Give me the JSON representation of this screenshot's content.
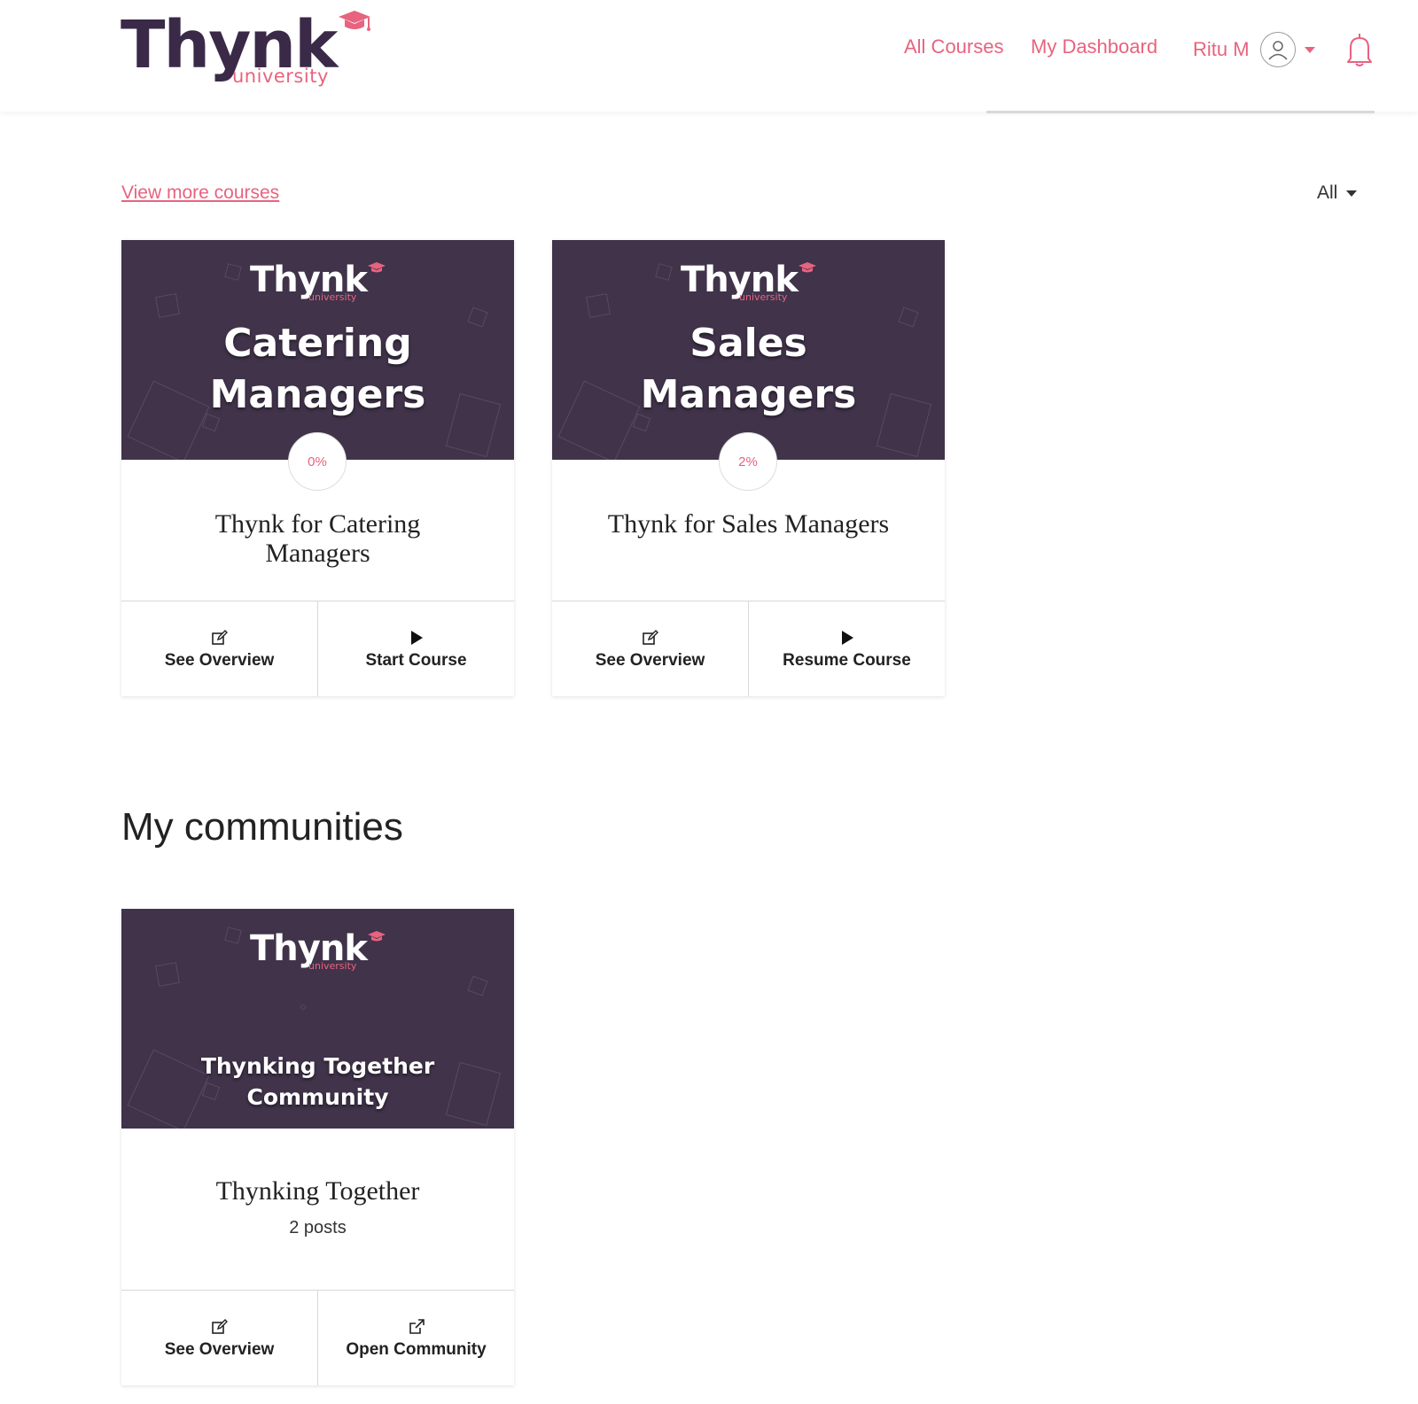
{
  "brand": {
    "name": "Thynk",
    "sub": "university",
    "colors": {
      "primary": "#3a2a48",
      "accent": "#e8637f",
      "banner": "#40334a"
    }
  },
  "nav": {
    "all_courses": "All Courses",
    "my_dashboard": "My Dashboard",
    "user_name": "Ritu M"
  },
  "courses": {
    "view_more": "View more courses",
    "filter_value": "All",
    "items": [
      {
        "banner_title_1": "Catering",
        "banner_title_2": "Managers",
        "progress": "0%",
        "title": "Thynk for Catering Managers",
        "action_1": "See Overview",
        "action_2": "Start Course"
      },
      {
        "banner_title_1": "Sales",
        "banner_title_2": "Managers",
        "progress": "2%",
        "title": "Thynk for Sales Managers",
        "action_1": "See Overview",
        "action_2": "Resume Course"
      }
    ]
  },
  "communities": {
    "heading": "My communities",
    "items": [
      {
        "banner_title_1": "Thynking Together",
        "banner_title_2": "Community",
        "title": "Thynking Together",
        "posts": "2 posts",
        "action_1": "See Overview",
        "action_2": "Open Community"
      }
    ]
  }
}
